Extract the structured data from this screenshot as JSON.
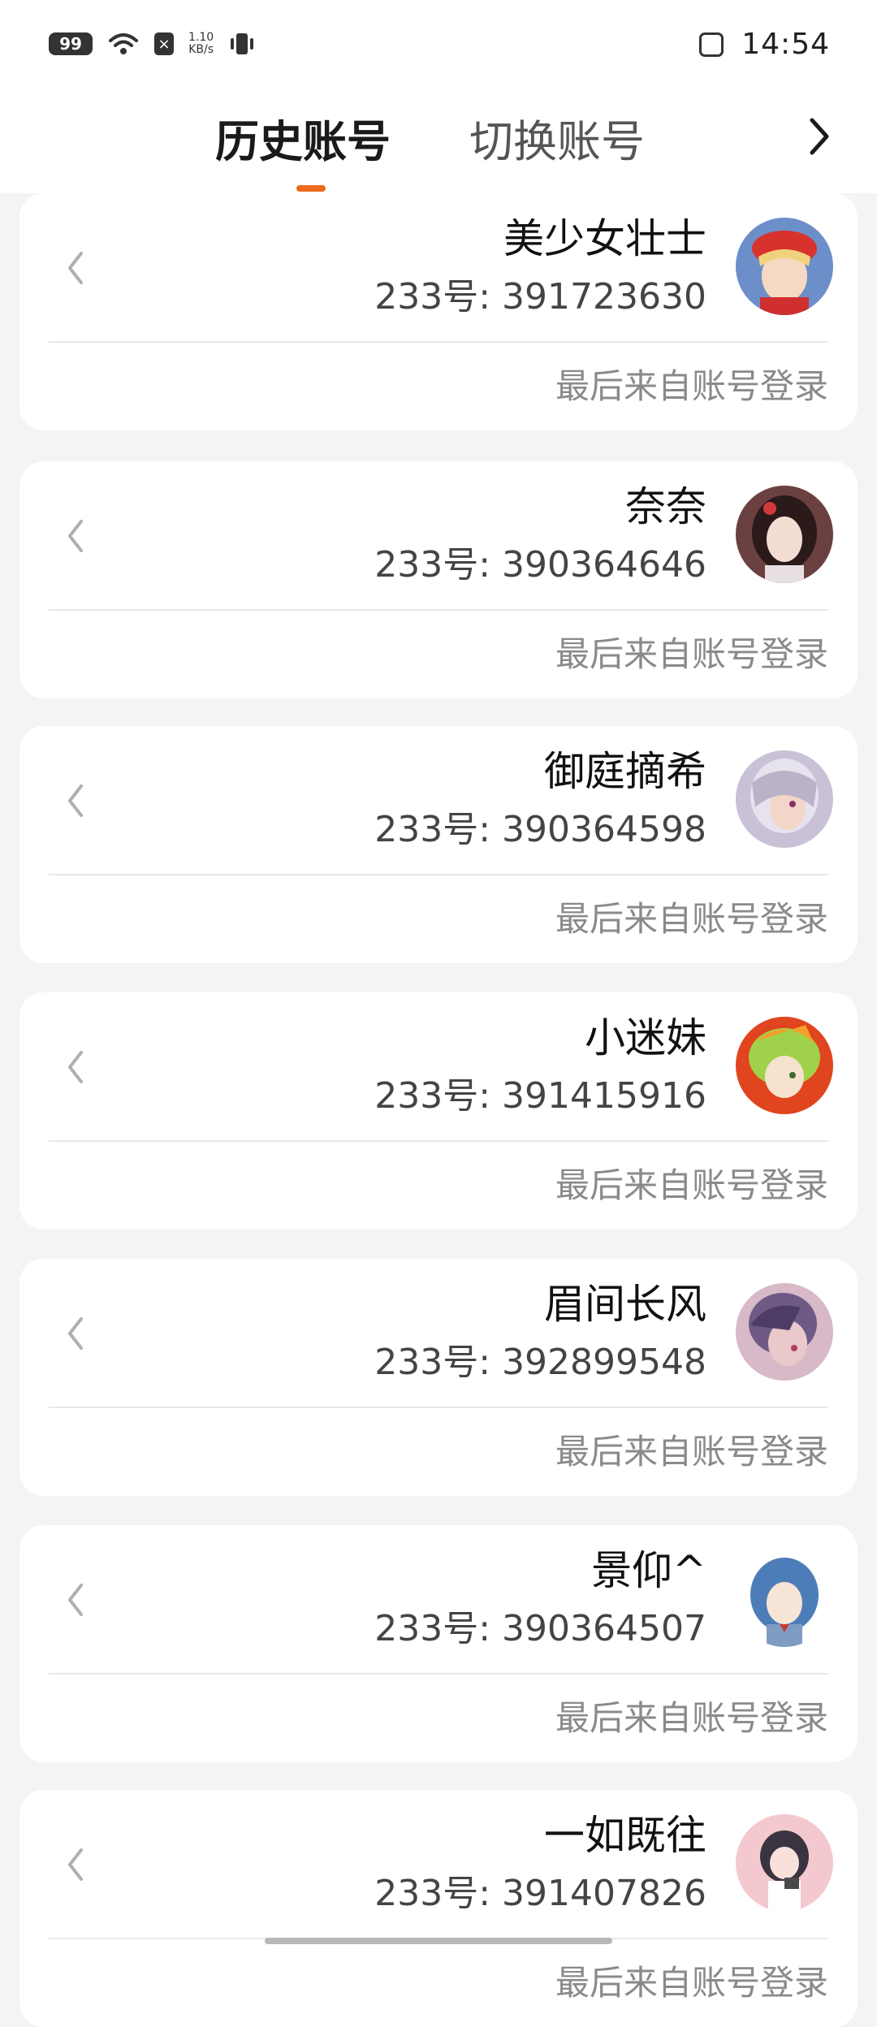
{
  "status_bar": {
    "battery": "99",
    "net_speed_value": "1.10",
    "net_speed_unit": "KB/s",
    "time": "14:54",
    "icons": [
      "battery-icon",
      "wifi-icon",
      "close-icon",
      "vibrate-icon",
      "app-icon"
    ]
  },
  "header": {
    "tabs": [
      {
        "label": "历史账号",
        "selected": true
      },
      {
        "label": "切换账号",
        "selected": false
      }
    ],
    "accent_color": "#ec6a1c",
    "nav_icon": "chevron-right-icon"
  },
  "accounts": [
    {
      "name": "美少女壮士",
      "uid": "233号: 391723630",
      "last_login": "最后来自账号登录"
    },
    {
      "name": "奈奈",
      "uid": "233号: 390364646",
      "last_login": "最后来自账号登录"
    },
    {
      "name": "御庭摘希",
      "uid": "233号: 390364598",
      "last_login": "最后来自账号登录"
    },
    {
      "name": "小迷妹",
      "uid": "233号: 391415916",
      "last_login": "最后来自账号登录"
    },
    {
      "name": "眉间长风",
      "uid": "233号: 392899548",
      "last_login": "最后来自账号登录"
    },
    {
      "name": "景仰^",
      "uid": "233号: 390364507",
      "last_login": "最后来自账号登录"
    },
    {
      "name": "一如既往",
      "uid": "233号: 391407826",
      "last_login": "最后来自账号登录"
    }
  ]
}
